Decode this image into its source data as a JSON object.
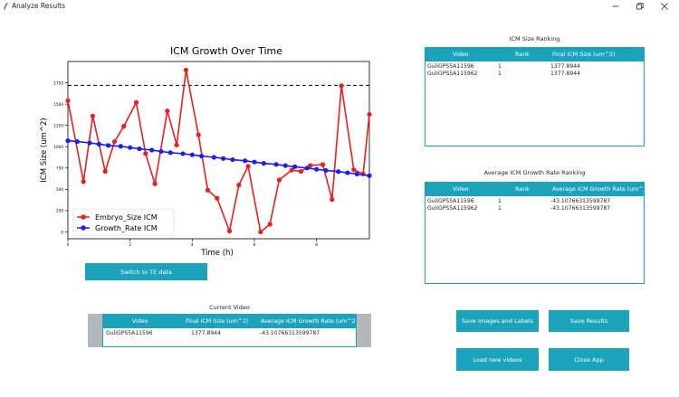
{
  "window": {
    "title": "Analyze Results",
    "minimize": "—",
    "restore": "❐",
    "close": "✕"
  },
  "chart_data": {
    "type": "line",
    "title": "ICM Growth Over Time",
    "xlabel": "Time (h)",
    "ylabel": "ICM Size (um^2)",
    "xlim": [
      0,
      9.7
    ],
    "ylim": [
      -80,
      2000
    ],
    "xticks": [
      0,
      2,
      4,
      6,
      8
    ],
    "yticks": [
      0,
      250,
      500,
      750,
      1000,
      1250,
      1500,
      1750
    ],
    "legend_position": "lower-left",
    "grid": false,
    "reference_line": {
      "y": 1720,
      "style": "dashed",
      "color": "#000000"
    },
    "series": [
      {
        "name": "Embryo_Size ICM",
        "color": "#ee1c1c",
        "x": [
          0,
          0.5,
          0.8,
          1.2,
          1.5,
          1.8,
          2.2,
          2.5,
          2.8,
          3.2,
          3.5,
          3.8,
          4.2,
          4.5,
          4.8,
          5.2,
          5.5,
          5.8,
          6.2,
          6.5,
          6.8,
          7.2,
          7.5,
          7.8,
          8.2,
          8.5,
          8.8,
          9.2,
          9.5,
          9.7
        ],
        "y": [
          1540,
          590,
          1360,
          710,
          1060,
          1240,
          1520,
          920,
          565,
          1420,
          1020,
          1900,
          1140,
          490,
          395,
          10,
          550,
          770,
          0,
          90,
          610,
          725,
          710,
          780,
          790,
          380,
          1715,
          730,
          680,
          1380
        ]
      },
      {
        "name": "Growth_Rate ICM",
        "color": "#1c1cee",
        "x": [
          0,
          0.3,
          0.7,
          1,
          1.3,
          1.7,
          2,
          2.3,
          2.7,
          3,
          3.3,
          3.7,
          4,
          4.3,
          4.7,
          5,
          5.3,
          5.7,
          6,
          6.3,
          6.7,
          7,
          7.3,
          7.7,
          8,
          8.3,
          8.7,
          9,
          9.3,
          9.7
        ],
        "y": [
          1070,
          1060,
          1045,
          1030,
          1015,
          1005,
          990,
          975,
          960,
          945,
          930,
          918,
          905,
          890,
          875,
          862,
          848,
          835,
          820,
          805,
          792,
          778,
          765,
          750,
          735,
          722,
          708,
          694,
          680,
          660
        ]
      }
    ]
  },
  "buttons": {
    "switch_te": "Switch to TE data",
    "save_images": "Save Images and Labels",
    "save_results": "Save Results",
    "load_videos": "Load new videos",
    "close_app": "Close App"
  },
  "icm_size_ranking": {
    "title": "ICM Size Ranking",
    "headers": [
      "Video",
      "Rank",
      "Final ICM Size (um^2)"
    ],
    "rows": [
      [
        "GuliGPS5A11596",
        "1",
        "1377.8944"
      ],
      [
        "GuliGPS5A115962",
        "1",
        "1377.8944"
      ]
    ]
  },
  "growth_rate_ranking": {
    "title": "Average ICM Growth Rate Ranking",
    "headers": [
      "Video",
      "Rank",
      "Average ICM Growth Rate (um^"
    ],
    "rows": [
      [
        "GuliGPS5A11596",
        "1",
        "-43.10766313599787"
      ],
      [
        "GuliGPS5A115962",
        "1",
        "-43.10766313599787"
      ]
    ]
  },
  "current_video": {
    "title": "Current Video",
    "headers": [
      "Video",
      "Final ICM Size (um^2)",
      "Average ICM Growth Rate (um^2"
    ],
    "rows": [
      [
        "GuliGPS5A11596",
        "1377.8944",
        "-43.10766313599787"
      ]
    ]
  },
  "colors": {
    "accent": "#1aa3bb",
    "frame_gray": "#b3b8bd"
  }
}
